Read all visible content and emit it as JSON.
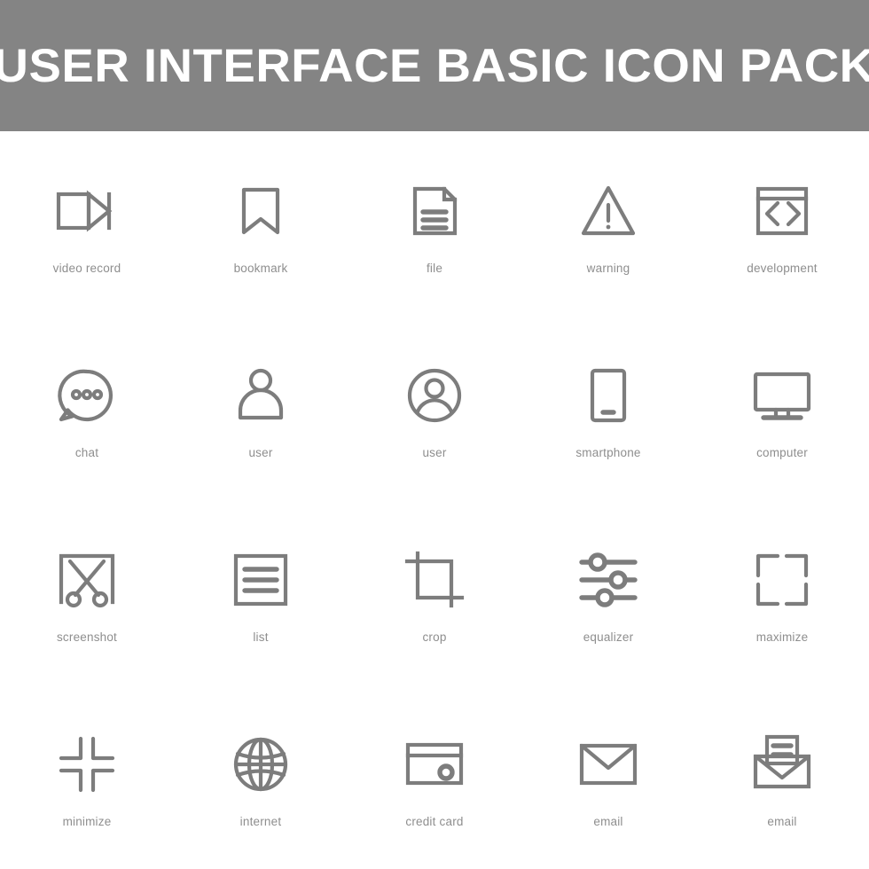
{
  "header": {
    "title": "USER INTERFACE BASIC ICON PACK",
    "background_color": "#848484",
    "text_color": "#ffffff"
  },
  "theme": {
    "page_background": "#ffffff",
    "icon_stroke_color": "#7d7d7d",
    "label_color": "#8e8e8e"
  },
  "grid": {
    "columns": 5,
    "rows": 4,
    "total_icons": 20
  },
  "icons": [
    {
      "name": "video-record",
      "label": "video record",
      "row": 1,
      "column": 1
    },
    {
      "name": "bookmark",
      "label": "bookmark",
      "row": 1,
      "column": 2
    },
    {
      "name": "file",
      "label": "file",
      "row": 1,
      "column": 3
    },
    {
      "name": "warning",
      "label": "warning",
      "row": 1,
      "column": 4
    },
    {
      "name": "development",
      "label": "development",
      "row": 1,
      "column": 5
    },
    {
      "name": "chat",
      "label": "chat",
      "row": 2,
      "column": 1
    },
    {
      "name": "user-person",
      "label": "user",
      "row": 2,
      "column": 2
    },
    {
      "name": "user-circle",
      "label": "user",
      "row": 2,
      "column": 3
    },
    {
      "name": "smartphone",
      "label": "smartphone",
      "row": 2,
      "column": 4
    },
    {
      "name": "computer",
      "label": "computer",
      "row": 2,
      "column": 5
    },
    {
      "name": "screenshot",
      "label": "screenshot",
      "row": 3,
      "column": 1
    },
    {
      "name": "list",
      "label": "list",
      "row": 3,
      "column": 2
    },
    {
      "name": "crop",
      "label": "crop",
      "row": 3,
      "column": 3
    },
    {
      "name": "equalizer",
      "label": "equalizer",
      "row": 3,
      "column": 4
    },
    {
      "name": "maximize",
      "label": "maximize",
      "row": 3,
      "column": 5
    },
    {
      "name": "minimize",
      "label": "minimize",
      "row": 4,
      "column": 1
    },
    {
      "name": "internet",
      "label": "internet",
      "row": 4,
      "column": 2
    },
    {
      "name": "credit-card",
      "label": "credit card",
      "row": 4,
      "column": 3
    },
    {
      "name": "email-closed",
      "label": "email",
      "row": 4,
      "column": 4
    },
    {
      "name": "email-open",
      "label": "email",
      "row": 4,
      "column": 5
    }
  ]
}
